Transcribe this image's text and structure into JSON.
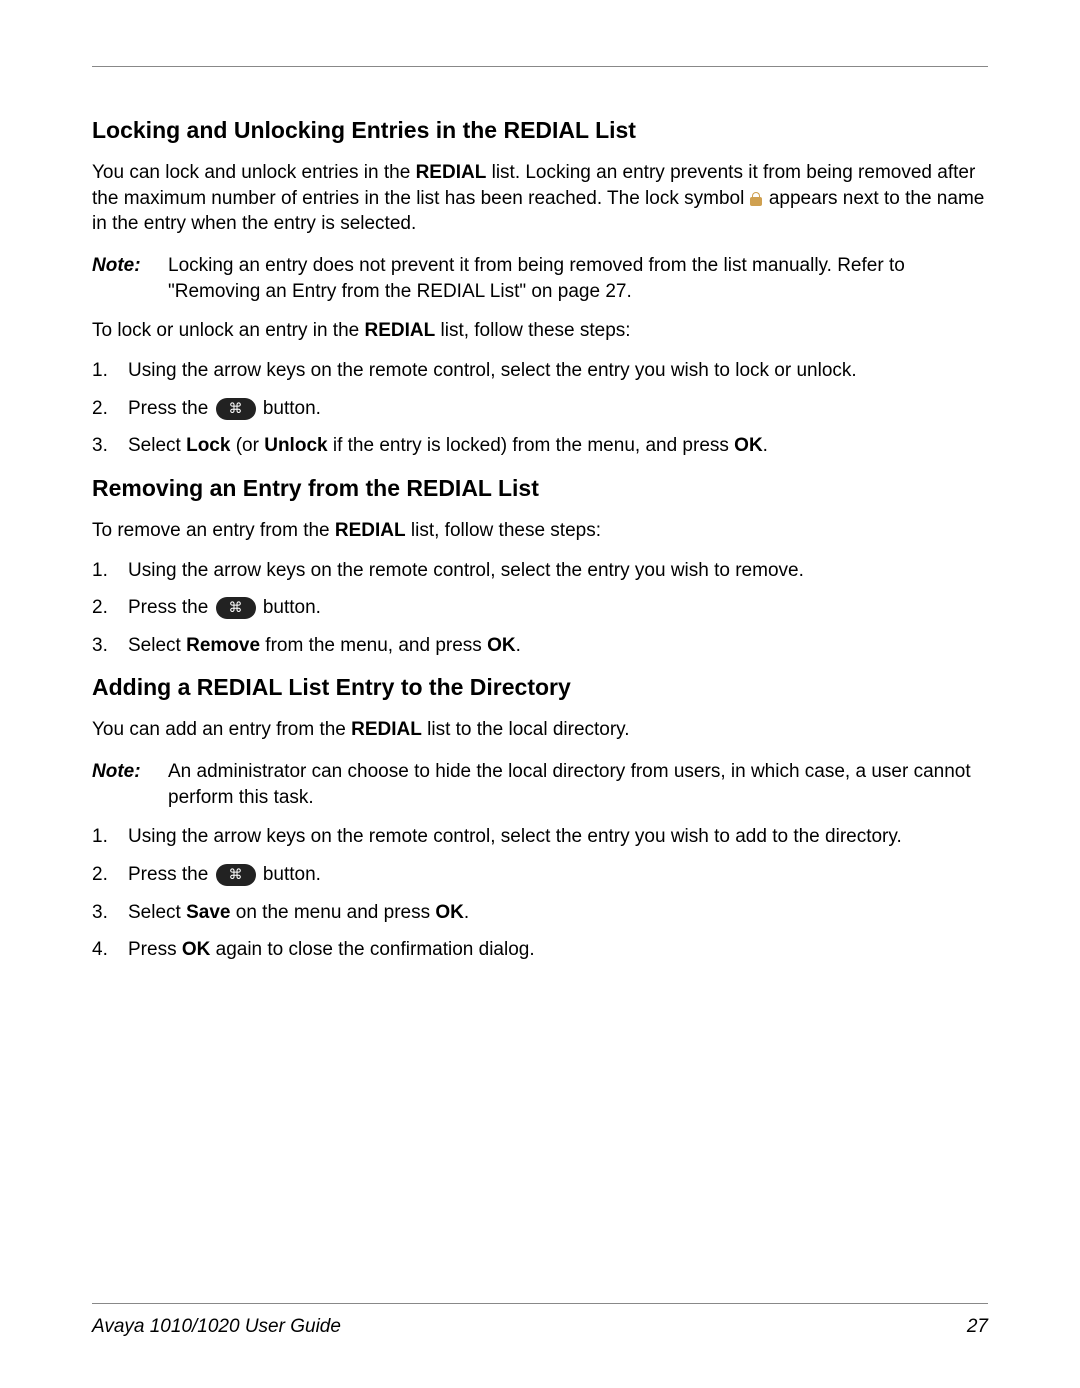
{
  "section1": {
    "heading": "Locking and Unlocking Entries in the REDIAL List",
    "p1_a": "You can lock and unlock entries in the ",
    "p1_b": "REDIAL",
    "p1_c": " list. Locking an entry prevents it from being removed after the maximum number of entries in the list has been reached. The lock symbol ",
    "p1_d": " appears next to the name in the entry when the entry is selected.",
    "note_label": "Note:",
    "note_body": "Locking an entry does not prevent it from being removed from the list manually. Refer to \"Removing an Entry from the REDIAL List\" on page 27.",
    "p2_a": "To lock or unlock an entry in the ",
    "p2_b": "REDIAL",
    "p2_c": " list, follow these steps:",
    "steps": [
      {
        "num": "1.",
        "text": "Using the arrow keys on the remote control, select the entry you wish to lock or unlock."
      },
      {
        "num": "2.",
        "a": "Press the ",
        "b": " button."
      },
      {
        "num": "3.",
        "a": "Select ",
        "b": "Lock",
        "c": " (or ",
        "d": "Unlock",
        "e": " if the entry is locked) from the menu, and press ",
        "f": "OK",
        "g": "."
      }
    ]
  },
  "section2": {
    "heading": "Removing an Entry from the REDIAL List",
    "p1_a": "To remove an entry from the ",
    "p1_b": "REDIAL",
    "p1_c": " list, follow these steps:",
    "steps": [
      {
        "num": "1.",
        "text": "Using the arrow keys on the remote control, select the entry you wish to remove."
      },
      {
        "num": "2.",
        "a": "Press the ",
        "b": " button."
      },
      {
        "num": "3.",
        "a": "Select ",
        "b": "Remove",
        "c": " from the menu, and press ",
        "d": "OK",
        "e": "."
      }
    ]
  },
  "section3": {
    "heading": "Adding a REDIAL List Entry to the Directory",
    "p1_a": "You can add an entry from the ",
    "p1_b": "REDIAL",
    "p1_c": " list to the local directory.",
    "note_label": "Note:",
    "note_body": "An administrator can choose to hide the local directory from users, in which case, a user cannot perform this task.",
    "steps": [
      {
        "num": "1.",
        "text": "Using the arrow keys on the remote control, select the entry you wish to add to the directory."
      },
      {
        "num": "2.",
        "a": "Press the ",
        "b": " button."
      },
      {
        "num": "3.",
        "a": "Select ",
        "b": "Save",
        "c": " on the menu and press ",
        "d": "OK",
        "e": "."
      },
      {
        "num": "4.",
        "a": "Press ",
        "b": "OK",
        "c": " again to close the confirmation dialog."
      }
    ]
  },
  "footer": {
    "title": "Avaya 1010/1020 User Guide",
    "page": "27"
  }
}
